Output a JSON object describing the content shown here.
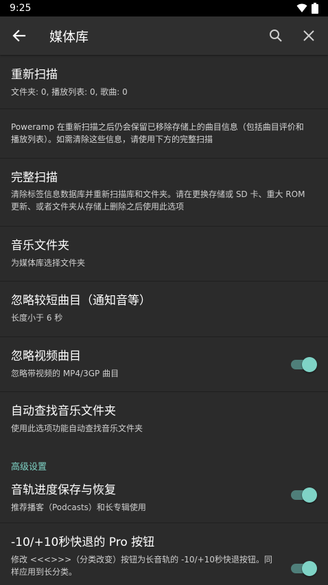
{
  "status": {
    "time": "9:25"
  },
  "appbar": {
    "title": "媒体库"
  },
  "items": [
    {
      "title": "重新扫描",
      "subtitle": "文件夹: 0, 播放列表: 0, 歌曲: 0"
    },
    {
      "note": "Poweramp 在重新扫描之后仍会保留已移除存储上的曲目信息（包括曲目评价和播放列表）。如需清除这些信息，请使用下方的完整扫描"
    },
    {
      "title": "完整扫描",
      "subtitle": "清除标签信息数据库并重新扫描库和文件夹。请在更换存储或 SD 卡、重大 ROM 更新、或者文件夹从存储上删除之后使用此选项"
    },
    {
      "title": "音乐文件夹",
      "subtitle": "为媒体库选择文件夹"
    },
    {
      "title": "忽略较短曲目（通知音等）",
      "subtitle": "长度小于 6 秒"
    },
    {
      "title": "忽略视频曲目",
      "subtitle": "忽略带视频的 MP4/3GP 曲目",
      "toggle": true
    },
    {
      "title": "自动查找音乐文件夹",
      "subtitle": "使用此选项功能自动查找音乐文件夹"
    }
  ],
  "advanced_header": "高级设置",
  "advanced_items": [
    {
      "title": "音轨进度保存与恢复",
      "subtitle": "推荐播客（Podcasts）和长专辑使用",
      "toggle": true
    },
    {
      "title": "-10/+10秒快退的 Pro 按钮",
      "subtitle": "修改 <<<>>>（分类改变）按钮为长音轨的 -10/+10秒快退按钮。同样应用到长分类。",
      "toggle": true
    }
  ],
  "colors": {
    "accent": "#7fd3c6",
    "background": "#2b2b2b",
    "appbar": "#2f2f2f"
  }
}
